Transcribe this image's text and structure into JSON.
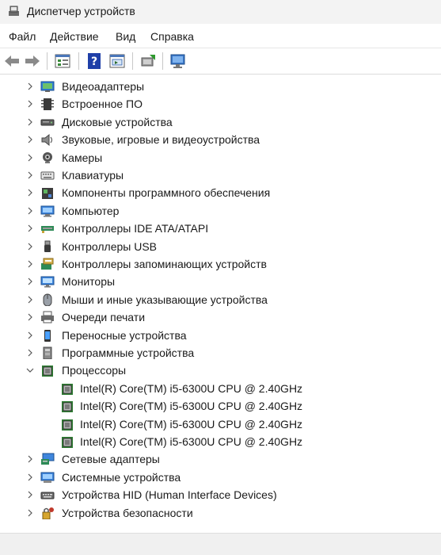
{
  "window": {
    "title": "Диспетчер устройств"
  },
  "menu": [
    "Файл",
    "Действие",
    "Вид",
    "Справка"
  ],
  "toolbar": [
    {
      "name": "back-icon"
    },
    {
      "name": "forward-icon"
    },
    {
      "name": "properties-icon"
    },
    {
      "name": "help-icon"
    },
    {
      "name": "show-hide-icon"
    },
    {
      "name": "update-driver-icon"
    },
    {
      "name": "scan-hardware-icon"
    }
  ],
  "tree": [
    {
      "label": "Видеоадаптеры",
      "icon": "display-adapter-icon",
      "expanded": false
    },
    {
      "label": "Встроенное ПО",
      "icon": "firmware-icon",
      "expanded": false
    },
    {
      "label": "Дисковые устройства",
      "icon": "disk-drive-icon",
      "expanded": false
    },
    {
      "label": "Звуковые, игровые и видеоустройства",
      "icon": "speaker-icon",
      "expanded": false
    },
    {
      "label": "Камеры",
      "icon": "camera-icon",
      "expanded": false
    },
    {
      "label": "Клавиатуры",
      "icon": "keyboard-icon",
      "expanded": false
    },
    {
      "label": "Компоненты программного обеспечения",
      "icon": "software-component-icon",
      "expanded": false
    },
    {
      "label": "Компьютер",
      "icon": "computer-icon",
      "expanded": false
    },
    {
      "label": "Контроллеры IDE ATA/ATAPI",
      "icon": "ide-controller-icon",
      "expanded": false
    },
    {
      "label": "Контроллеры USB",
      "icon": "usb-icon",
      "expanded": false
    },
    {
      "label": "Контроллеры запоминающих устройств",
      "icon": "storage-controller-icon",
      "expanded": false
    },
    {
      "label": "Мониторы",
      "icon": "monitor-icon",
      "expanded": false
    },
    {
      "label": "Мыши и иные указывающие устройства",
      "icon": "mouse-icon",
      "expanded": false
    },
    {
      "label": "Очереди печати",
      "icon": "printer-icon",
      "expanded": false
    },
    {
      "label": "Переносные устройства",
      "icon": "portable-device-icon",
      "expanded": false
    },
    {
      "label": "Программные устройства",
      "icon": "software-device-icon",
      "expanded": false
    },
    {
      "label": "Процессоры",
      "icon": "processor-icon",
      "expanded": true,
      "children": [
        "Intel(R) Core(TM) i5-6300U CPU @ 2.40GHz",
        "Intel(R) Core(TM) i5-6300U CPU @ 2.40GHz",
        "Intel(R) Core(TM) i5-6300U CPU @ 2.40GHz",
        "Intel(R) Core(TM) i5-6300U CPU @ 2.40GHz"
      ]
    },
    {
      "label": "Сетевые адаптеры",
      "icon": "network-adapter-icon",
      "expanded": false
    },
    {
      "label": "Системные устройства",
      "icon": "system-device-icon",
      "expanded": false
    },
    {
      "label": "Устройства HID (Human Interface Devices)",
      "icon": "hid-icon",
      "expanded": false
    },
    {
      "label": "Устройства безопасности",
      "icon": "security-device-icon",
      "expanded": false
    }
  ]
}
